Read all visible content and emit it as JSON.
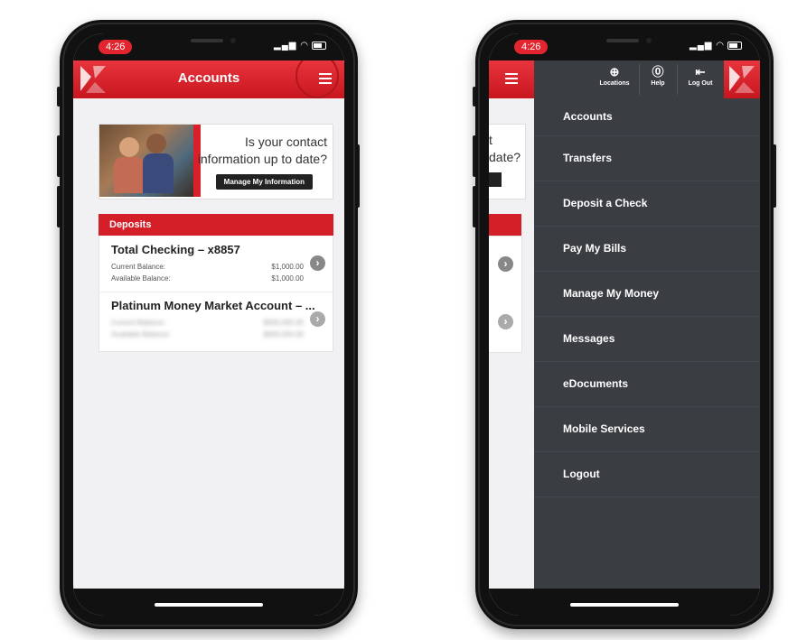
{
  "status": {
    "time": "4:26",
    "signal": "..ıl",
    "wifi": "ᯤ"
  },
  "left_phone": {
    "header": {
      "title": "Accounts"
    },
    "promo": {
      "text_line1": "Is your contact",
      "text_line2": "information up to date?",
      "button": "Manage My Information"
    },
    "section_title": "Deposits",
    "accounts": [
      {
        "name": "Total Checking – x8857",
        "rows": [
          {
            "label": "Current Balance:",
            "value": "$1,000.00"
          },
          {
            "label": "Available Balance:",
            "value": "$1,000.00"
          }
        ]
      },
      {
        "name": "Platinum Money Market Account – ...",
        "rows": [
          {
            "label": "Current Balance:",
            "value": "$000,000.00"
          },
          {
            "label": "Available Balance:",
            "value": "$000,000.00"
          }
        ]
      }
    ]
  },
  "right_phone": {
    "toolbar": {
      "locations": "Locations",
      "help": "Help",
      "logout": "Log Out"
    },
    "peek": {
      "line1": "t",
      "line2": "date?"
    },
    "menu": [
      "Accounts",
      "Transfers",
      "Deposit a Check",
      "Pay My Bills",
      "Manage My Money",
      "Messages",
      "eDocuments",
      "Mobile Services",
      "Logout"
    ]
  },
  "colors": {
    "brand_red": "#d41f29",
    "drawer": "#3a3d42",
    "bezel": "#111111"
  }
}
